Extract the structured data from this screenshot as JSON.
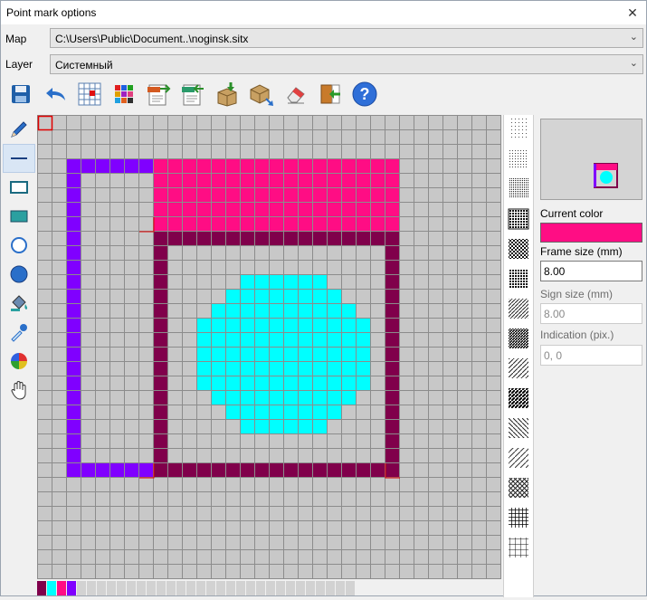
{
  "window": {
    "title": "Point mark options",
    "close": "✕"
  },
  "map": {
    "label": "Map",
    "value": "C:\\Users\\Public\\Document..\\noginsk.sitx"
  },
  "layer": {
    "label": "Layer",
    "value": "Системный"
  },
  "toolbar": [
    "save-icon",
    "undo-icon",
    "grid-icon",
    "color-grid-icon",
    "png-ico-export-icon",
    "png-ico-import-icon",
    "box-in-icon",
    "box-out-icon",
    "eraser-icon",
    "exit-icon",
    "help-icon"
  ],
  "help_glyph": "?",
  "tools": [
    "pencil-icon",
    "line-icon",
    "rectangle-icon",
    "filled-rectangle-icon",
    "circle-icon",
    "filled-circle-icon",
    "fill-bucket-icon",
    "eyedropper-icon",
    "color-wheel-icon",
    "hand-icon"
  ],
  "colors": {
    "magenta": "#ff0d84",
    "violet": "#8000ff",
    "maroon": "#80004b",
    "cyan": "#00ffff",
    "grid_bg": "#c8c8c8"
  },
  "palette": [
    "#80004b",
    "#00ffff",
    "#ff0d84",
    "#8000ff"
  ],
  "palette_empty_count": 28,
  "panel": {
    "current_color_label": "Current color",
    "current_color": "#ff0d84",
    "frame_size_label": "Frame size (mm)",
    "frame_size_value": "8.00",
    "sign_size_label": "Sign size (mm)",
    "sign_size_value": "8.00",
    "indication_label": "Indication (pix.)",
    "indication_value": "0, 0"
  }
}
